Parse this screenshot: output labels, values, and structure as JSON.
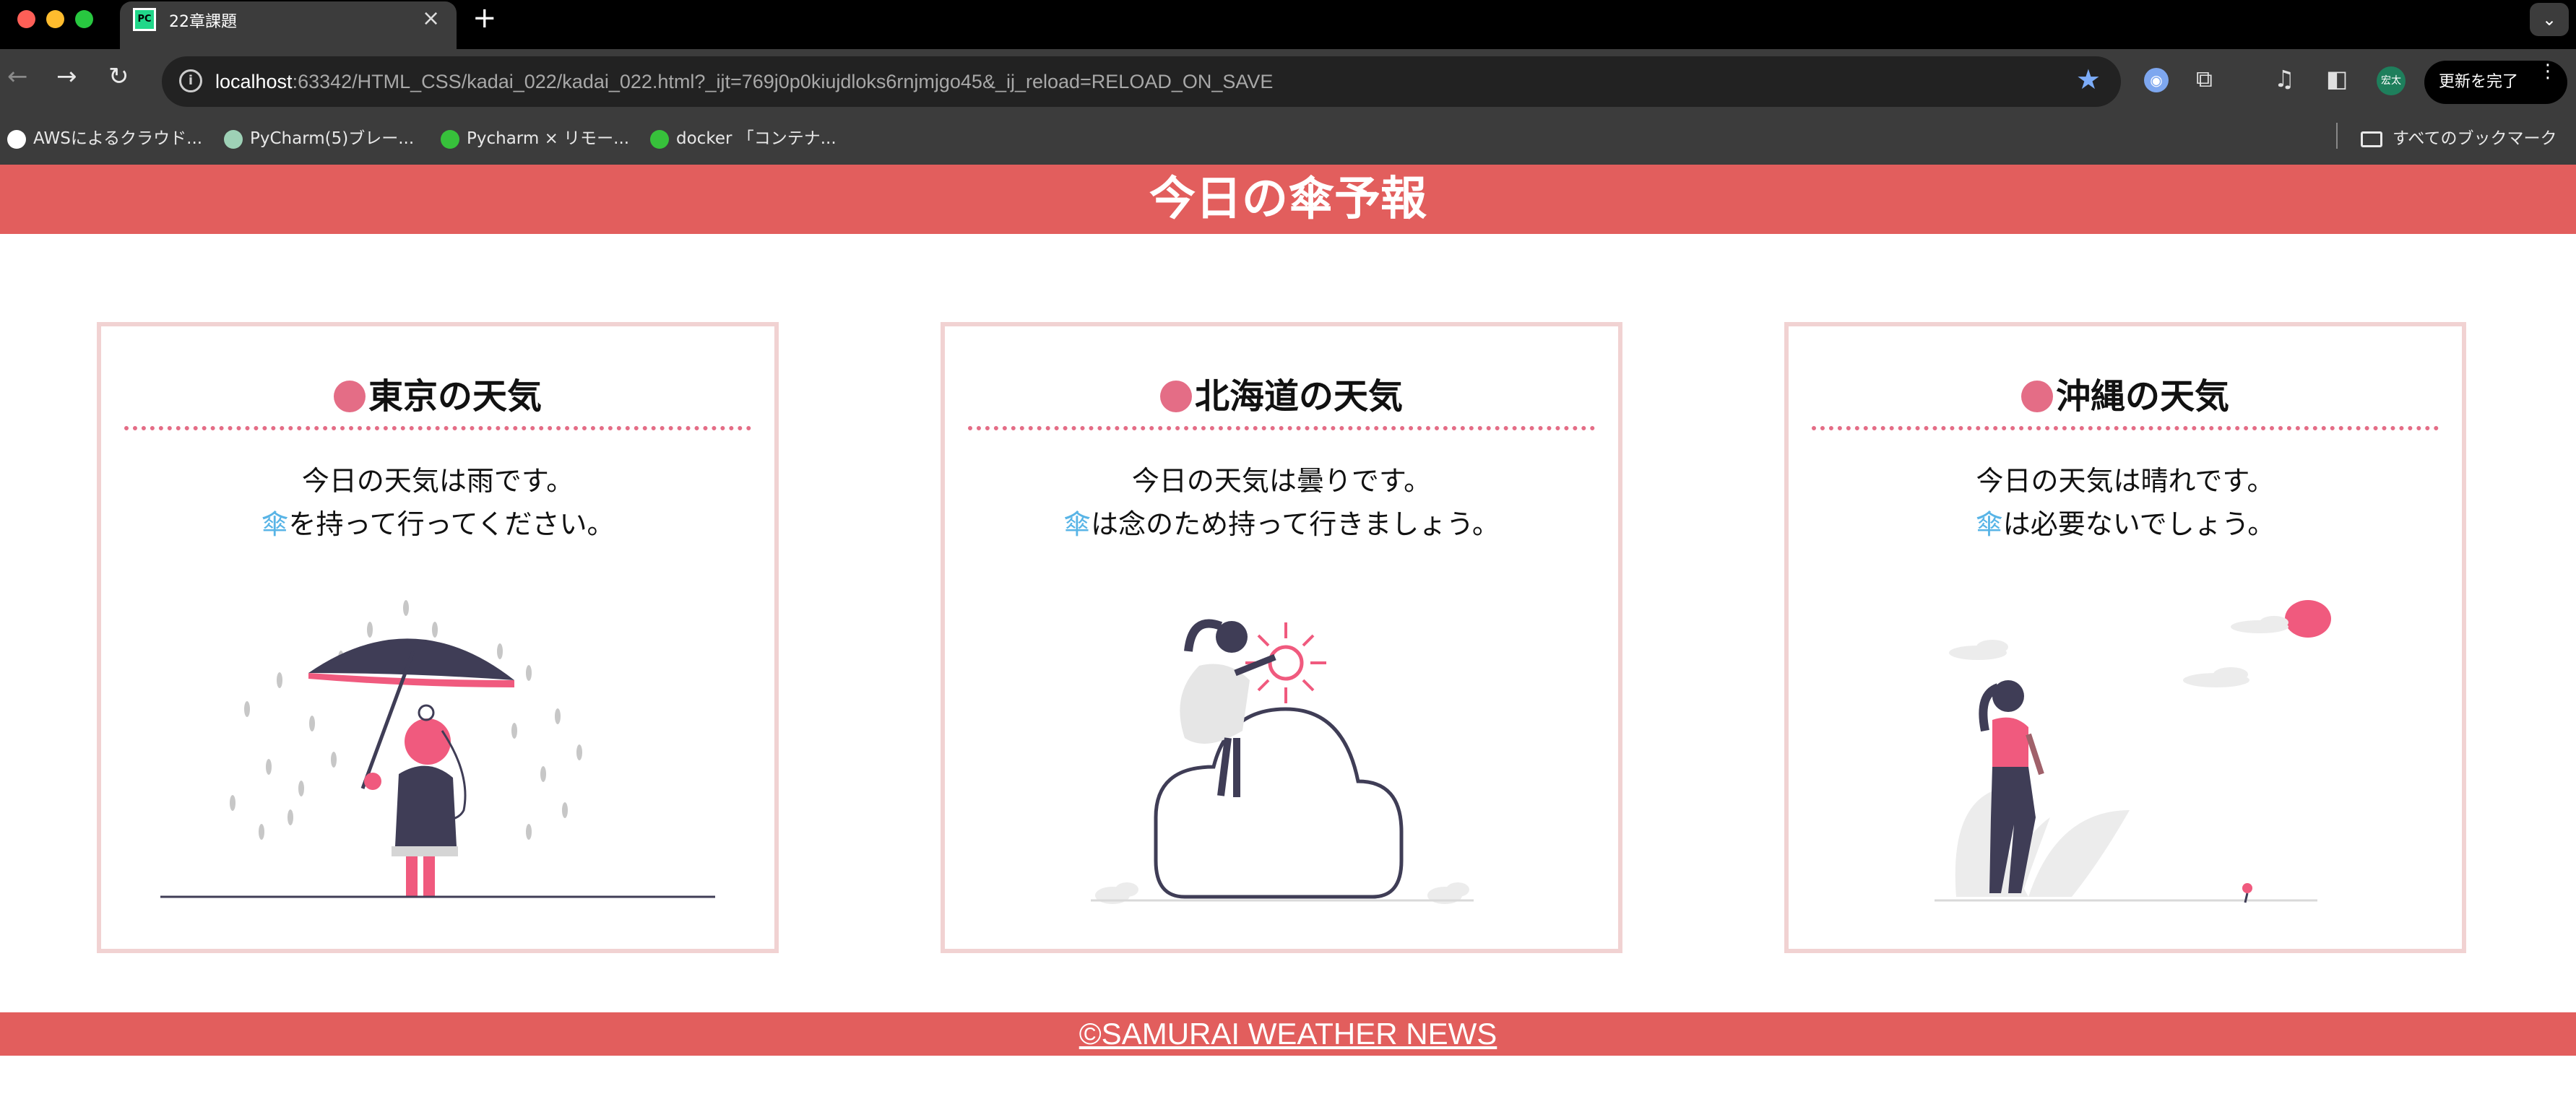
{
  "browser": {
    "tab_title": "22章課題",
    "tab_favicon": "PC",
    "url_host": "localhost",
    "url_rest": ":63342/HTML_CSS/kadai_022/kadai_022.html?_ijt=769j0p0kiujdloks6rnjmjgo45&_ij_reload=RELOAD_ON_SAVE",
    "profile_label": "宏太",
    "update_button": "更新を完了",
    "bookmarks": [
      {
        "label": "AWSによるクラウド..."
      },
      {
        "label": "PyCharm(5)ブレー..."
      },
      {
        "label": "Pycharm × リモー..."
      },
      {
        "label": "docker 「コンテナ..."
      }
    ],
    "all_bookmarks": "すべてのブックマーク"
  },
  "page": {
    "title": "今日の傘予報",
    "cards": [
      {
        "heading": "東京の天気",
        "line1": "今日の天気は雨です。",
        "umbrella": "傘",
        "line2": "を持って行ってください。"
      },
      {
        "heading": "北海道の天気",
        "line1": "今日の天気は曇りです。",
        "umbrella": "傘",
        "line2": "は念のため持って行きましょう。"
      },
      {
        "heading": "沖縄の天気",
        "line1": "今日の天気は晴れです。",
        "umbrella": "傘",
        "line2": "は必要ないでしょう。"
      }
    ],
    "footer": "©SAMURAI WEATHER NEWS"
  },
  "colors": {
    "header_bg": "#e25e5d",
    "accent_pink": "#e46d86",
    "umbrella_blue": "#58b4e6",
    "card_border": "#f1d2d2"
  }
}
